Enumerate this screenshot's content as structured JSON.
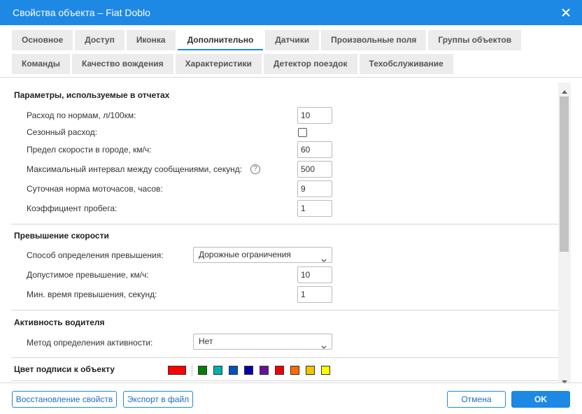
{
  "window": {
    "title": "Свойства объекта – Fiat Doblo"
  },
  "tabs": {
    "row1": [
      "Основное",
      "Доступ",
      "Иконка",
      "Дополнительно",
      "Датчики",
      "Произвольные поля",
      "Группы объектов"
    ],
    "row2": [
      "Команды",
      "Качество вождения",
      "Характеристики",
      "Детектор поездок",
      "Техобслуживание"
    ],
    "active": "Дополнительно"
  },
  "report_params": {
    "title": "Параметры, используемые в отчетах",
    "fuel_rate_label": "Расход по нормам, л/100км:",
    "fuel_rate_value": "10",
    "seasonal_label": "Сезонный расход:",
    "seasonal_checked": false,
    "city_speed_label": "Предел скорости в городе, км/ч:",
    "city_speed_value": "60",
    "max_interval_label": "Максимальный интервал между сообщениями, секунд:",
    "max_interval_value": "500",
    "help_glyph": "?",
    "engine_hours_label": "Суточная норма моточасов, часов:",
    "engine_hours_value": "9",
    "mileage_coef_label": "Коэффициент пробега:",
    "mileage_coef_value": "1"
  },
  "speeding": {
    "title": "Превышение скорости",
    "method_label": "Способ определения превышения:",
    "method_value": "Дорожные ограничения",
    "allowed_label": "Допустимое превышение, км/ч:",
    "allowed_value": "10",
    "min_time_label": "Мин. время превышения, секунд:",
    "min_time_value": "1"
  },
  "driver_activity": {
    "title": "Активность водителя",
    "method_label": "Метод определения активности:",
    "method_value": "Нет"
  },
  "label_color": {
    "title": "Цвет подписи к объекту",
    "current": "#ff0000",
    "palette": [
      "#008000",
      "#00b0b0",
      "#0050c0",
      "#0000a0",
      "#6a0f9a",
      "#ee0000",
      "#ff6a00",
      "#f5c400",
      "#ffff00"
    ]
  },
  "footer": {
    "restore_label": "Восстановление свойств",
    "export_label": "Экспорт в файл",
    "cancel_label": "Отмена",
    "ok_label": "OK"
  },
  "colors": {
    "accent": "#1e88e5"
  },
  "icons": {
    "close": "close-icon",
    "help": "help-icon",
    "dropdown": "chevron-down-icon"
  }
}
